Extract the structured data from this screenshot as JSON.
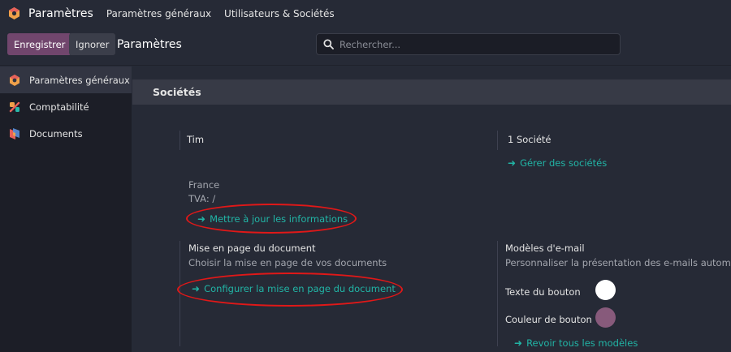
{
  "navbar": {
    "app_name": "Paramètres",
    "items": [
      "Paramètres généraux",
      "Utilisateurs & Sociétés"
    ]
  },
  "control": {
    "save_label": "Enregistrer",
    "discard_label": "Ignorer",
    "title": "Paramètres",
    "search_placeholder": "Rechercher..."
  },
  "sidebar": {
    "items": [
      {
        "label": "Paramètres généraux",
        "icon": "odoo-settings-icon"
      },
      {
        "label": "Comptabilité",
        "icon": "accounting-icon"
      },
      {
        "label": "Documents",
        "icon": "documents-icon"
      }
    ]
  },
  "main": {
    "section_title": "Sociétés",
    "company": {
      "name": "Tim",
      "country": "France",
      "vat": "TVA:  /",
      "update_link": "Mettre à jour les informations"
    },
    "companies": {
      "count": "1 Société",
      "manage_link": "Gérer des sociétés"
    },
    "layout": {
      "title": "Mise en page du document",
      "desc": "Choisir la mise en page de vos documents",
      "configure_link": "Configurer la mise en page du document"
    },
    "email": {
      "title": "Modèles d'e-mail",
      "desc": "Personnaliser la présentation des e-mails automatisés",
      "button_text_label": "Texte du bouton",
      "button_color_label": "Couleur de bouton",
      "review_link": "Revoir tous les modèles"
    }
  },
  "colors": {
    "accent": "#21b5a6",
    "primary": "#71466d",
    "button_text_color": "#ffffff",
    "button_color": "#875a7b",
    "annotation": "#e01818"
  }
}
